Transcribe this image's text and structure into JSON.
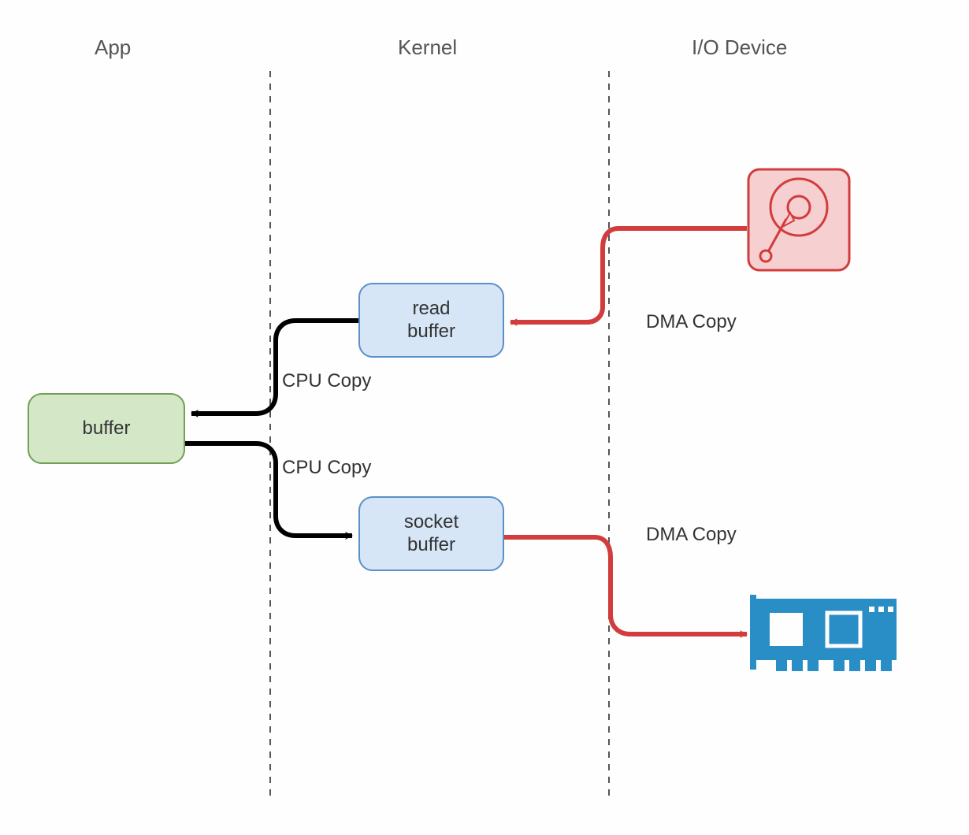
{
  "headers": {
    "app": "App",
    "kernel": "Kernel",
    "io_device": "I/O Device"
  },
  "boxes": {
    "app_buffer": "buffer",
    "read_buffer": "read buffer",
    "socket_buffer": "socket buffer"
  },
  "edges": {
    "cpu_copy_1": "CPU Copy",
    "cpu_copy_2": "CPU Copy",
    "dma_copy_1": "DMA Copy",
    "dma_copy_2": "DMA Copy"
  },
  "icons": {
    "disk": "hard-disk-icon",
    "nic": "network-card-icon"
  },
  "colors": {
    "green_fill": "#d4e8c8",
    "green_border": "#6fa055",
    "blue_fill": "#d6e6f7",
    "blue_border": "#5a8fc7",
    "red_line": "#d23c3c",
    "disk_fill": "#f6cfd0",
    "disk_border": "#d23c3c",
    "nic_fill": "#2a8ec6"
  }
}
